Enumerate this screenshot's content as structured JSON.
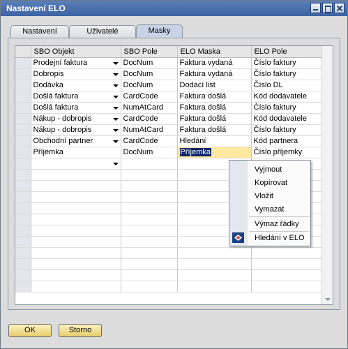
{
  "window": {
    "title": "Nastavení ELO"
  },
  "tabs": [
    {
      "label": "Nastavení",
      "active": false
    },
    {
      "label": "Uživatelé",
      "active": false
    },
    {
      "label": "Masky",
      "active": true
    }
  ],
  "table": {
    "columns": [
      "",
      "SBO Objekt",
      "SBO Pole",
      "ELO Maska",
      "ELO Pole"
    ],
    "rows": [
      {
        "objekt": "Prodejní faktura",
        "pole": "DocNum",
        "maska": "Faktura vydaná",
        "elo_pole": "Číslo faktury"
      },
      {
        "objekt": "Dobropis",
        "pole": "DocNum",
        "maska": "Faktura vydaná",
        "elo_pole": "Číslo faktury"
      },
      {
        "objekt": "Dodávka",
        "pole": "DocNum",
        "maska": "Dodací list",
        "elo_pole": "Číslo DL"
      },
      {
        "objekt": "Došlá faktura",
        "pole": "CardCode",
        "maska": "Faktura došlá",
        "elo_pole": "Kód dodavatele"
      },
      {
        "objekt": "Došlá faktura",
        "pole": "NumAtCard",
        "maska": "Faktura došlá",
        "elo_pole": "Číslo faktury"
      },
      {
        "objekt": "Nákup - dobropis",
        "pole": "CardCode",
        "maska": "Faktura došlá",
        "elo_pole": "Kód dodavatele"
      },
      {
        "objekt": "Nákup - dobropis",
        "pole": "NumAtCard",
        "maska": "Faktura došlá",
        "elo_pole": "Číslo faktury"
      },
      {
        "objekt": "Obchodní partner",
        "pole": "CardCode",
        "maska": "Hledání",
        "elo_pole": "Kód partnera"
      },
      {
        "objekt": "Příjemka",
        "pole": "DocNum",
        "maska": "Příjemka",
        "elo_pole": "Číslo příjemky"
      }
    ]
  },
  "context_menu": {
    "items": [
      "Vyjmout",
      "Kopírovat",
      "Vložit",
      "Vymazat",
      "Výmaz řádky",
      "Hledání v ELO"
    ]
  },
  "buttons": {
    "ok": "OK",
    "cancel": "Storno"
  },
  "colors": {
    "title_bar": "#3d63a3",
    "selection": "#0a246a",
    "active_cell": "#ffe8a0",
    "button": "#f0d77e"
  }
}
